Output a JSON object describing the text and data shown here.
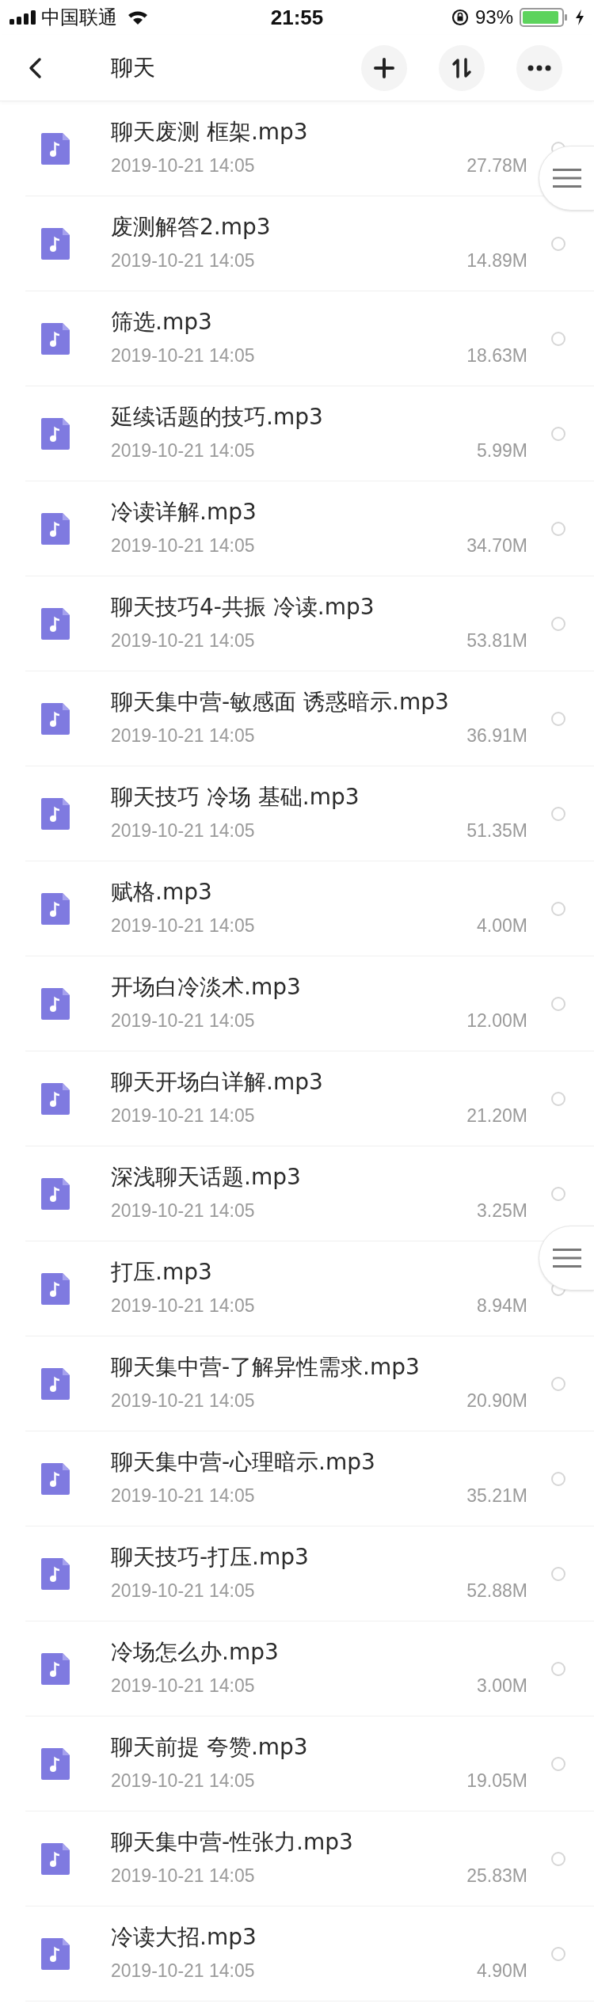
{
  "status_bar": {
    "carrier": "中国联通",
    "time": "21:55",
    "battery": "93%"
  },
  "header": {
    "title": "聊天"
  },
  "files": [
    {
      "name": "聊天废测  框架.mp3",
      "date": "2019-10-21 14:05",
      "size": "27.78M",
      "selected": false
    },
    {
      "name": "废测解答2.mp3",
      "date": "2019-10-21 14:05",
      "size": "14.89M",
      "selected": false
    },
    {
      "name": "筛选.mp3",
      "date": "2019-10-21 14:05",
      "size": "18.63M",
      "selected": false
    },
    {
      "name": "延续话题的技巧.mp3",
      "date": "2019-10-21 14:05",
      "size": "5.99M",
      "selected": false
    },
    {
      "name": "冷读详解.mp3",
      "date": "2019-10-21 14:05",
      "size": "34.70M",
      "selected": false
    },
    {
      "name": "聊天技巧4-共振 冷读.mp3",
      "date": "2019-10-21 14:05",
      "size": "53.81M",
      "selected": false
    },
    {
      "name": "聊天集中营-敏感面 诱惑暗示.mp3",
      "date": "2019-10-21 14:05",
      "size": "36.91M",
      "selected": false
    },
    {
      "name": "聊天技巧 冷场 基础.mp3",
      "date": "2019-10-21 14:05",
      "size": "51.35M",
      "selected": false
    },
    {
      "name": "赋格.mp3",
      "date": "2019-10-21 14:05",
      "size": "4.00M",
      "selected": false
    },
    {
      "name": "开场白冷淡术.mp3",
      "date": "2019-10-21 14:05",
      "size": "12.00M",
      "selected": false
    },
    {
      "name": "聊天开场白详解.mp3",
      "date": "2019-10-21 14:05",
      "size": "21.20M",
      "selected": false
    },
    {
      "name": "深浅聊天话题.mp3",
      "date": "2019-10-21 14:05",
      "size": "3.25M",
      "selected": false
    },
    {
      "name": "打压.mp3",
      "date": "2019-10-21 14:05",
      "size": "8.94M",
      "selected": false
    },
    {
      "name": "聊天集中营-了解异性需求.mp3",
      "date": "2019-10-21 14:05",
      "size": "20.90M",
      "selected": false
    },
    {
      "name": "聊天集中营-心理暗示.mp3",
      "date": "2019-10-21 14:05",
      "size": "35.21M",
      "selected": false
    },
    {
      "name": "聊天技巧-打压.mp3",
      "date": "2019-10-21 14:05",
      "size": "52.88M",
      "selected": false
    },
    {
      "name": "冷场怎么办.mp3",
      "date": "2019-10-21 14:05",
      "size": "3.00M",
      "selected": false
    },
    {
      "name": "聊天前提 夸赞.mp3",
      "date": "2019-10-21 14:05",
      "size": "19.05M",
      "selected": false
    },
    {
      "name": "聊天集中营-性张力.mp3",
      "date": "2019-10-21 14:05",
      "size": "25.83M",
      "selected": false
    },
    {
      "name": "冷读大招.mp3",
      "date": "2019-10-21 14:05",
      "size": "4.90M",
      "selected": false
    }
  ]
}
